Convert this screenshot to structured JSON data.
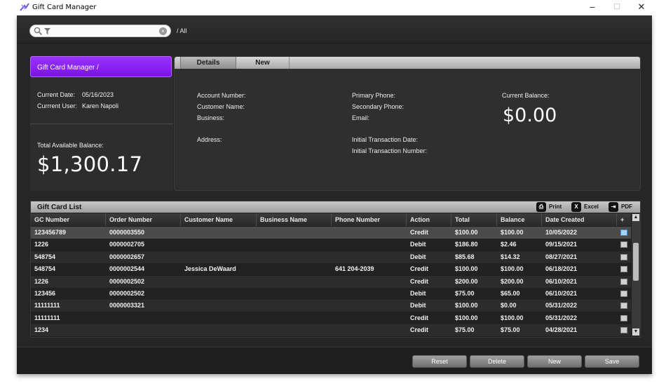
{
  "window": {
    "title": "Gift Card Manager",
    "controls": {
      "minimize": "–",
      "maximize": "☐",
      "close": "✕"
    }
  },
  "search": {
    "value": "",
    "placeholder": "",
    "breadcrumb": "/ All"
  },
  "left_panel": {
    "module_button": "Gift Card Manager /",
    "current_date_label": "Current Date:",
    "current_date": "05/16/2023",
    "current_user_label": "Currrent User:",
    "current_user": "Karen Napoli",
    "total_balance_label": "Total Available Balance:",
    "total_balance": "$1,300.17"
  },
  "details": {
    "tabs": [
      "Details",
      "New"
    ],
    "account_number_label": "Account Number:",
    "customer_name_label": "Customer Name:",
    "business_label": "Business:",
    "address_label": "Address:",
    "primary_phone_label": "Primary Phone:",
    "secondary_phone_label": "Secondary Phone:",
    "email_label": "Email:",
    "initial_transaction_date_label": "Initial Transaction Date:",
    "initial_transaction_number_label": "Initial Transaction Number:",
    "current_balance_label": "Current Balance:",
    "current_balance": "$0.00"
  },
  "gift_card_list": {
    "title": "Gift Card List",
    "export": {
      "print": "Print",
      "excel": "Excel",
      "pdf": "PDF"
    },
    "columns": [
      "GC Number",
      "Order Number",
      "Customer Name",
      "Business Name",
      "Phone Number",
      "Action",
      "Total",
      "Balance",
      "Date Created",
      "+"
    ],
    "rows": [
      {
        "gc_number": "123456789",
        "order_number": "0000003550",
        "customer_name": "",
        "business_name": "",
        "phone_number": "",
        "action": "Credit",
        "total": "$100.00",
        "balance": "$100.00",
        "date_created": "10/05/2022",
        "checked": true
      },
      {
        "gc_number": "1226",
        "order_number": "0000002705",
        "customer_name": "",
        "business_name": "",
        "phone_number": "",
        "action": "Debit",
        "total": "$186.80",
        "balance": "$2.46",
        "date_created": "09/15/2021",
        "checked": false
      },
      {
        "gc_number": "548754",
        "order_number": "0000002657",
        "customer_name": "",
        "business_name": "",
        "phone_number": "",
        "action": "Debit",
        "total": "$85.68",
        "balance": "$14.32",
        "date_created": "08/27/2021",
        "checked": false
      },
      {
        "gc_number": "548754",
        "order_number": "0000002544",
        "customer_name": "Jessica DeWaard",
        "business_name": "",
        "phone_number": "641 204-2039",
        "action": "Credit",
        "total": "$100.00",
        "balance": "$100.00",
        "date_created": "06/18/2021",
        "checked": false
      },
      {
        "gc_number": "1226",
        "order_number": "0000002502",
        "customer_name": "",
        "business_name": "",
        "phone_number": "",
        "action": "Credit",
        "total": "$200.00",
        "balance": "$200.00",
        "date_created": "06/10/2021",
        "checked": false
      },
      {
        "gc_number": "123456",
        "order_number": "0000002502",
        "customer_name": "",
        "business_name": "",
        "phone_number": "",
        "action": "Debit",
        "total": "$75.00",
        "balance": "$65.00",
        "date_created": "06/10/2021",
        "checked": false
      },
      {
        "gc_number": "11111111",
        "order_number": "0000003321",
        "customer_name": "",
        "business_name": "",
        "phone_number": "",
        "action": "Debit",
        "total": "$100.00",
        "balance": "$0.00",
        "date_created": "05/31/2022",
        "checked": false
      },
      {
        "gc_number": "11111111",
        "order_number": "",
        "customer_name": "",
        "business_name": "",
        "phone_number": "",
        "action": "Credit",
        "total": "$100.00",
        "balance": "$100.00",
        "date_created": "05/31/2022",
        "checked": false
      },
      {
        "gc_number": "1234",
        "order_number": "",
        "customer_name": "",
        "business_name": "",
        "phone_number": "",
        "action": "Credit",
        "total": "$75.00",
        "balance": "$75.00",
        "date_created": "04/28/2021",
        "checked": false
      }
    ]
  },
  "buttons": {
    "reset": "Reset",
    "delete": "Delete",
    "new": "New",
    "save": "Save"
  },
  "colors": {
    "accent": "#8a22f5",
    "background": "#262626"
  }
}
